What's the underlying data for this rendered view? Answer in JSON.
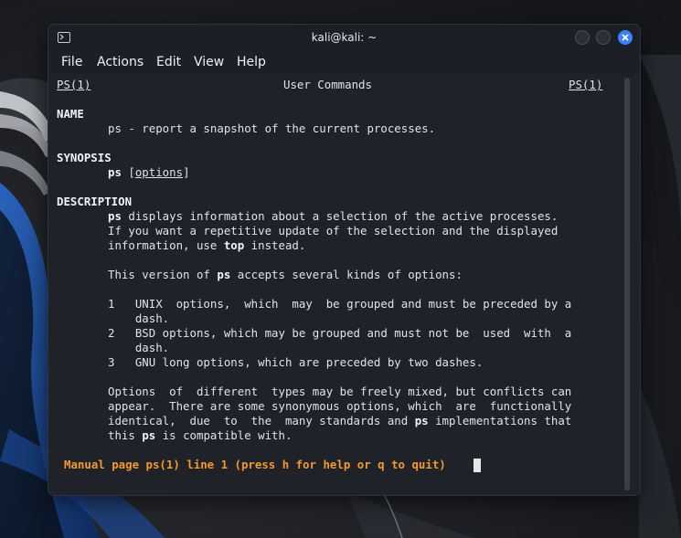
{
  "window": {
    "title": "kali@kali: ~"
  },
  "menu": [
    "File",
    "Actions",
    "Edit",
    "View",
    "Help"
  ],
  "man": {
    "header_left": "PS(1)",
    "header_center": "User Commands",
    "header_right": "PS(1)",
    "name_heading": "NAME",
    "name_text": "ps - report a snapshot of the current processes.",
    "synopsis_heading": "SYNOPSIS",
    "synopsis_cmd": "ps",
    "synopsis_options": "options",
    "description_heading": "DESCRIPTION",
    "desc_line1_cmd": "ps",
    "desc_line1_rest": " displays information about a selection of the active processes.",
    "desc_line2": "If you want a repetitive update of the selection and the displayed",
    "desc_line3_pre": "information, use ",
    "desc_line3_cmd": "top",
    "desc_line3_post": " instead.",
    "version_pre": "This version of ",
    "version_cmd": "ps",
    "version_post": " accepts several kinds of options:",
    "opt1_line1": "1   UNIX  options,  which  may  be grouped and must be preceded by a",
    "opt1_line2": "    dash.",
    "opt2_line1": "2   BSD options, which may be grouped and must not be  used  with  a",
    "opt2_line2": "    dash.",
    "opt3_line1": "3   GNU long options, which are preceded by two dashes.",
    "mix_line1": "Options  of  different  types may be freely mixed, but conflicts can",
    "mix_line2": "appear.  There are some synonymous options, which  are  functionally",
    "mix_line3_pre": "identical,  due  to  the  many standards and ",
    "mix_line3_cmd": "ps",
    "mix_line3_post": " implementations that",
    "mix_line4_pre": "this ",
    "mix_line4_cmd": "ps",
    "mix_line4_post": " is compatible with."
  },
  "status_line": "Manual page ps(1) line 1 (press h for help or q to quit)",
  "colors": {
    "terminal_bg": "#1f2229",
    "text": "#e1e3e7",
    "prompt": "#f39a2b",
    "close_button": "#3b82f6"
  }
}
